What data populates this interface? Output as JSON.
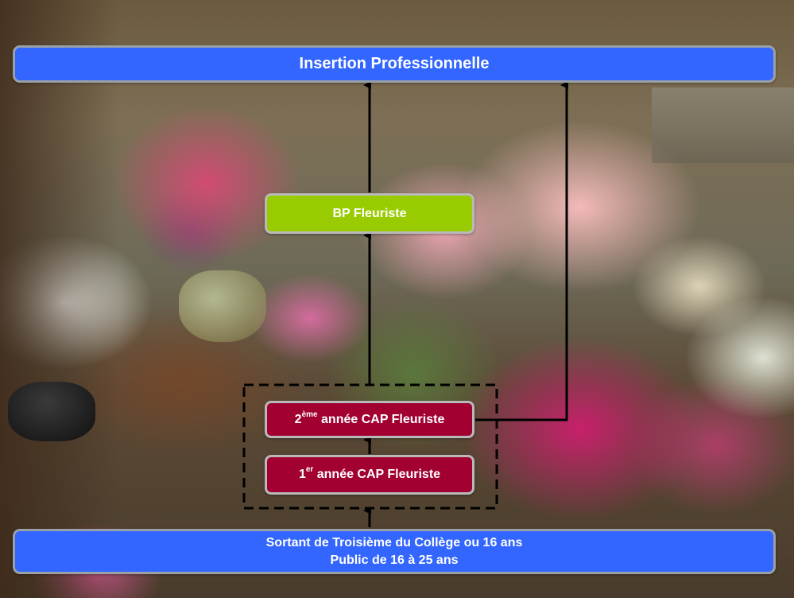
{
  "top_bar": {
    "label": "Insertion Professionnelle"
  },
  "bp_box": {
    "label": "BP Fleuriste"
  },
  "cap2_box": {
    "ordinal": "2",
    "superscript": "ème",
    "label": " année CAP Fleuriste"
  },
  "cap1_box": {
    "ordinal": "1",
    "superscript": "er",
    "label": " année CAP Fleuriste"
  },
  "bottom_bar": {
    "line1": "Sortant de Troisième du Collège ou 16 ans",
    "line2": "Public de 16 à 25 ans"
  },
  "colors": {
    "bar_blue": "#3366ff",
    "bp_green": "#99cc00",
    "cap_maroon": "#a10031",
    "box_border": "#b9b9b9",
    "connector": "#000000"
  }
}
